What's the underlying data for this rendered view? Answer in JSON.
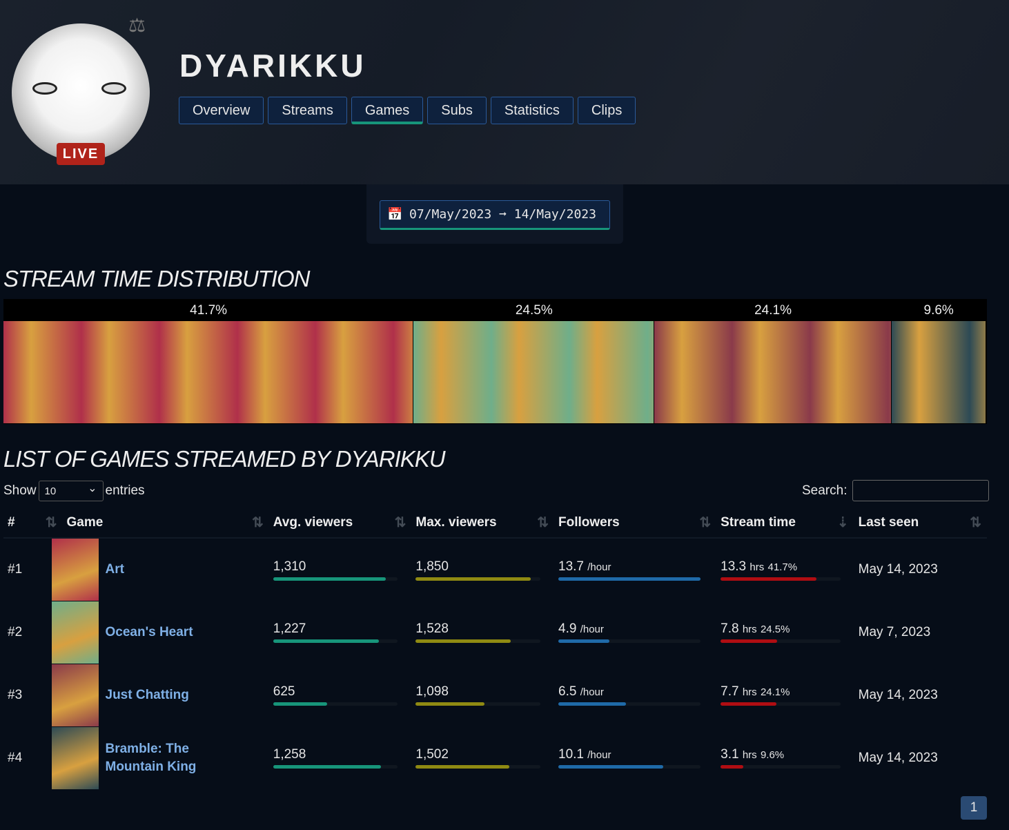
{
  "channel": {
    "name": "DYARIKKU",
    "live_label": "LIVE"
  },
  "tabs": [
    {
      "label": "Overview"
    },
    {
      "label": "Streams"
    },
    {
      "label": "Games",
      "active": true
    },
    {
      "label": "Subs"
    },
    {
      "label": "Statistics"
    },
    {
      "label": "Clips"
    }
  ],
  "date_range": {
    "start": "07/May/2023",
    "arrow": "➞",
    "end": "14/May/2023"
  },
  "distribution": {
    "title": "STREAM TIME DISTRIBUTION",
    "segments": [
      {
        "game": "Art",
        "pct": "41.7%",
        "value": 41.7,
        "color": "#b0304a"
      },
      {
        "game": "Ocean's Heart",
        "pct": "24.5%",
        "value": 24.5,
        "color": "#6fae8a"
      },
      {
        "game": "Just Chatting",
        "pct": "24.1%",
        "value": 24.1,
        "color": "#8a3a4a"
      },
      {
        "game": "Bramble: The Mountain King",
        "pct": "9.6%",
        "value": 9.6,
        "color": "#2d4a55"
      }
    ]
  },
  "list": {
    "title": "LIST OF GAMES STREAMED BY DYARIKKU",
    "show_label": "Show",
    "entries_value": "10",
    "entries_label": "entries",
    "search_label": "Search:",
    "search_value": "",
    "columns": [
      "#",
      "Game",
      "Avg. viewers",
      "Max. viewers",
      "Followers",
      "Stream time",
      "Last seen"
    ],
    "rows": [
      {
        "rank": "#1",
        "game": "Art",
        "avg": "1,310",
        "avg_n": 1310,
        "max": "1,850",
        "max_n": 1850,
        "followers": "13.7",
        "followers_n": 13.7,
        "followers_unit": "/hour",
        "time": "13.3",
        "time_n": 13.3,
        "time_unit": "hrs",
        "time_pct": "41.7%",
        "last_seen": "May 14, 2023",
        "color": "#b0304a"
      },
      {
        "rank": "#2",
        "game": "Ocean's Heart",
        "avg": "1,227",
        "avg_n": 1227,
        "max": "1,528",
        "max_n": 1528,
        "followers": "4.9",
        "followers_n": 4.9,
        "followers_unit": "/hour",
        "time": "7.8",
        "time_n": 7.8,
        "time_unit": "hrs",
        "time_pct": "24.5%",
        "last_seen": "May 7, 2023",
        "color": "#6fae8a"
      },
      {
        "rank": "#3",
        "game": "Just Chatting",
        "avg": "625",
        "avg_n": 625,
        "max": "1,098",
        "max_n": 1098,
        "followers": "6.5",
        "followers_n": 6.5,
        "followers_unit": "/hour",
        "time": "7.7",
        "time_n": 7.7,
        "time_unit": "hrs",
        "time_pct": "24.1%",
        "last_seen": "May 14, 2023",
        "color": "#8a3a4a"
      },
      {
        "rank": "#4",
        "game": "Bramble: The Mountain King",
        "avg": "1,258",
        "avg_n": 1258,
        "max": "1,502",
        "max_n": 1502,
        "followers": "10.1",
        "followers_n": 10.1,
        "followers_unit": "/hour",
        "time": "3.1",
        "time_n": 3.1,
        "time_unit": "hrs",
        "time_pct": "9.6%",
        "last_seen": "May 14, 2023",
        "color": "#2d4a55"
      }
    ]
  },
  "pagination": {
    "current": "1"
  },
  "colors": {
    "avg": "#17957a",
    "max": "#8f8a12",
    "followers": "#1f6aa8",
    "time": "#b00d12"
  }
}
